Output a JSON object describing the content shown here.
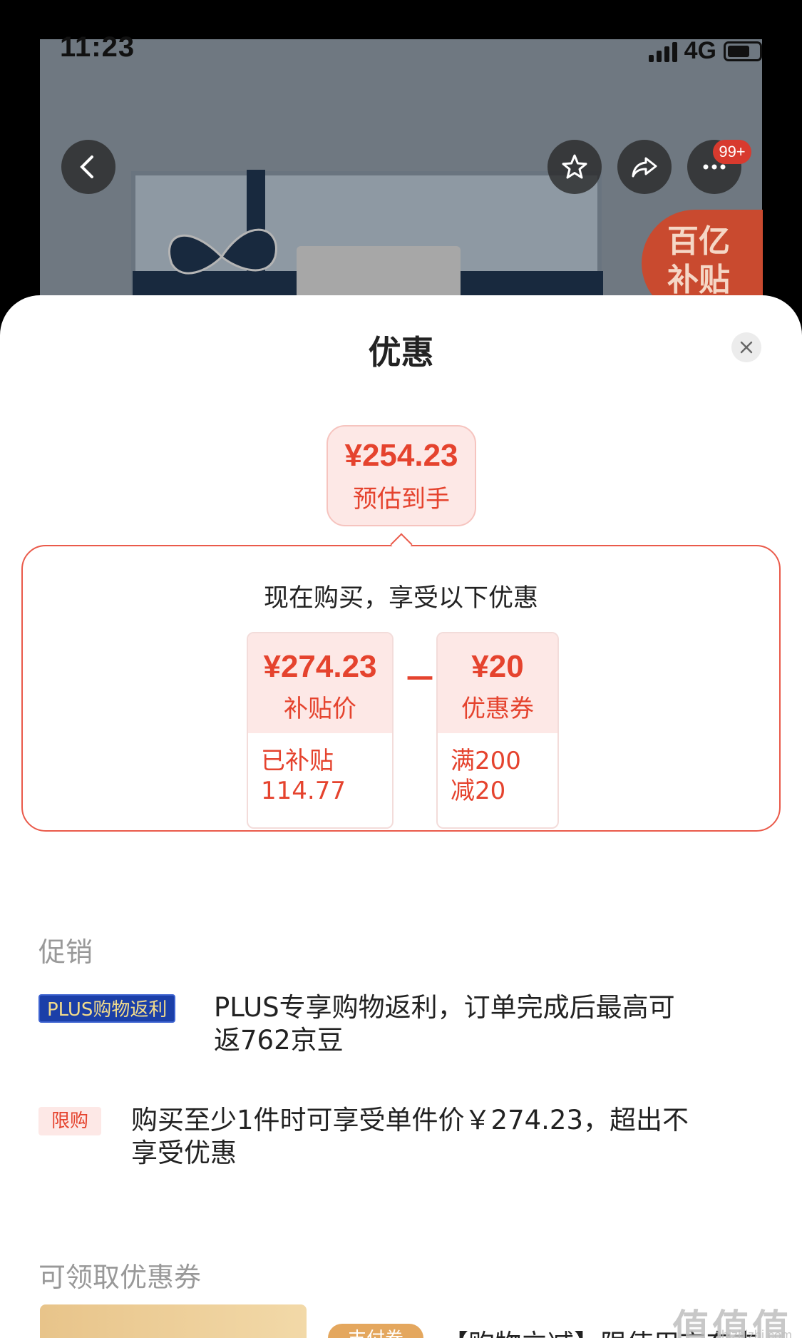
{
  "status_bar": {
    "time": "11:23",
    "network": "4G"
  },
  "product_page": {
    "more_badge": "99+",
    "subsidy_badge": [
      "百亿",
      "补贴"
    ]
  },
  "sheet": {
    "title": "优惠",
    "estimate": {
      "price": "¥254.23",
      "label": "预估到手"
    },
    "breakdown": {
      "title": "现在购买，享受以下优惠",
      "subsidy": {
        "price": "¥274.23",
        "label": "补贴价",
        "detail_line1": "已补贴",
        "detail_line2": "114.77"
      },
      "operator": "－",
      "coupon": {
        "price": "¥20",
        "label": "优惠券",
        "detail_line1": "满200",
        "detail_line2": "减20"
      }
    },
    "promotions": {
      "heading": "促销",
      "items": [
        {
          "tag": "PLUS购物返利",
          "text_line1": "PLUS专享购物返利，订单完成后最高可",
          "text_line2": "返762京豆"
        },
        {
          "tag": "限购",
          "text_line1": "购买至少1件时可享受单件价￥274.23，超出不",
          "text_line2": "享受优惠"
        }
      ]
    },
    "coupons": {
      "heading": "可领取优惠券",
      "first_tag": "支付券",
      "first_text": "【购物立减】限使用京东支"
    }
  },
  "watermark": {
    "main": "值值值",
    "sub": "zhizhizhi.com"
  },
  "colors": {
    "accent": "#e5432e",
    "accent_light": "#fde8e6",
    "plus_blue": "#1b3fa8"
  }
}
